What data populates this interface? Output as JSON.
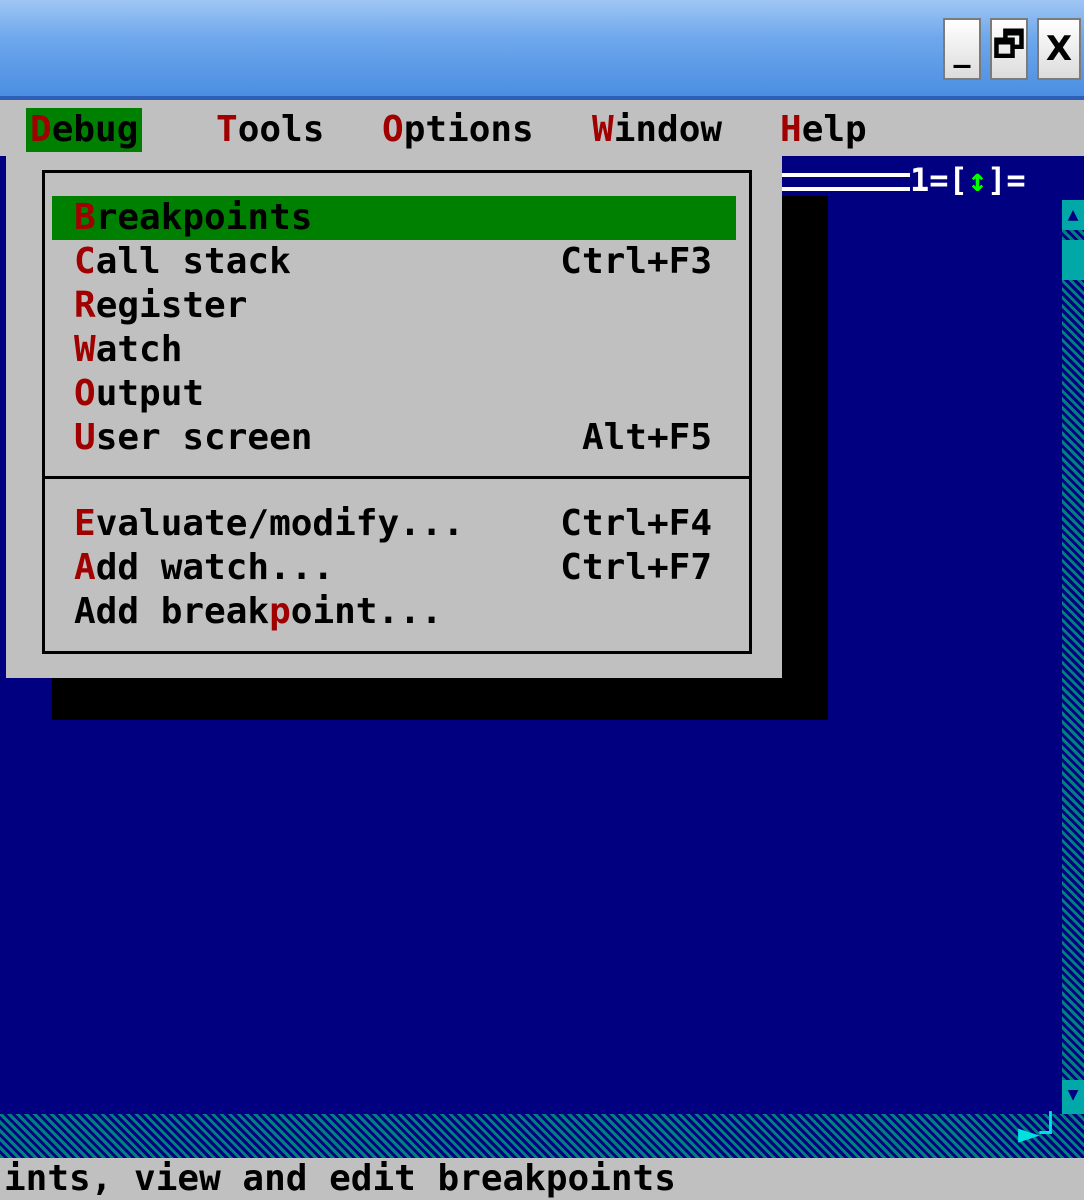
{
  "window_controls": {
    "minimize": "_",
    "maximize": "🗗",
    "close": "X"
  },
  "menubar": {
    "items": [
      {
        "hot": "D",
        "rest": "ebug",
        "active": true
      },
      {
        "hot": "T",
        "rest": "ools"
      },
      {
        "hot": "O",
        "rest": "ptions"
      },
      {
        "hot": "W",
        "rest": "indow"
      },
      {
        "hot": "H",
        "rest": "elp"
      }
    ]
  },
  "editor": {
    "window_number_label": "1=[",
    "window_number_arrow": "↕",
    "window_number_close": "]="
  },
  "debug_menu": {
    "group1": [
      {
        "pre": "",
        "hot": "B",
        "post": "reakpoints",
        "shortcut": "",
        "highlighted": true
      },
      {
        "pre": "",
        "hot": "C",
        "post": "all stack",
        "shortcut": "Ctrl+F3"
      },
      {
        "pre": "",
        "hot": "R",
        "post": "egister",
        "shortcut": ""
      },
      {
        "pre": "",
        "hot": "W",
        "post": "atch",
        "shortcut": ""
      },
      {
        "pre": "",
        "hot": "O",
        "post": "utput",
        "shortcut": ""
      },
      {
        "pre": "",
        "hot": "U",
        "post": "ser screen",
        "shortcut": "Alt+F5"
      }
    ],
    "group2": [
      {
        "pre": "",
        "hot": "E",
        "post": "valuate/modify...",
        "shortcut": "Ctrl+F4"
      },
      {
        "pre": "",
        "hot": "A",
        "post": "dd watch...",
        "shortcut": "Ctrl+F7"
      },
      {
        "pre": "Add break",
        "hot": "p",
        "post": "oint...",
        "shortcut": ""
      }
    ]
  },
  "statusbar": {
    "text": "ints, view and edit breakpoints"
  },
  "colors": {
    "desktop_blue": "#000080",
    "menu_gray": "#c0c0c0",
    "highlight_green": "#008000",
    "hotkey_red": "#a00000"
  }
}
